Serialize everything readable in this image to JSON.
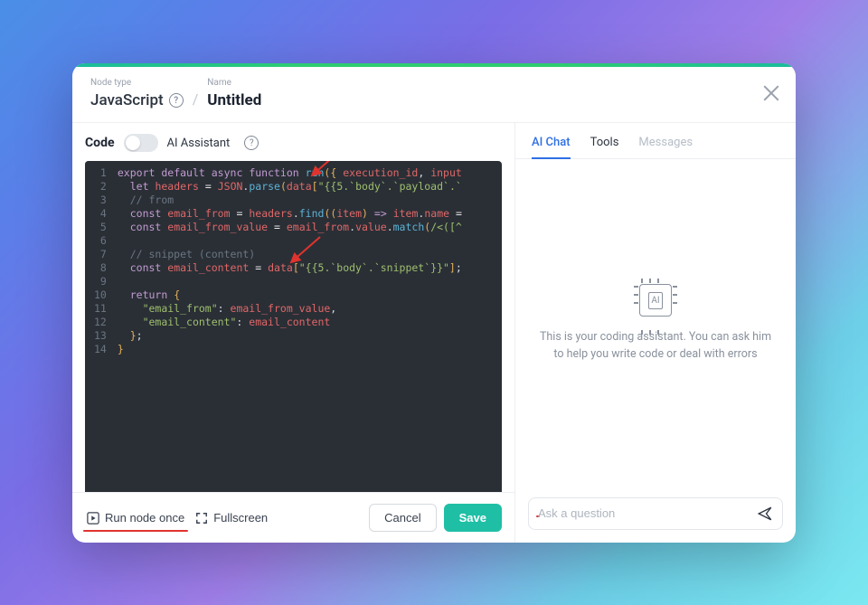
{
  "header": {
    "node_type_label": "Node type",
    "node_type": "JavaScript",
    "name_label": "Name",
    "name": "Untitled"
  },
  "left": {
    "code_label": "Code",
    "ai_assistant_label": "AI Assistant",
    "run_label": "Run node once",
    "fullscreen_label": "Fullscreen",
    "cancel_label": "Cancel",
    "save_label": "Save"
  },
  "code_lines": [
    "export default async function run({ execution_id, input",
    "  let headers = JSON.parse(data[\"{{5.`body`.`payload`.`",
    "  // from",
    "  const email_from = headers.find((item) => item.name =",
    "  const email_from_value = email_from.value.match(/<([^",
    "",
    "  // snippet (content)",
    "  const email_content = data[\"{{5.`body`.`snippet`}}\"];",
    "",
    "  return {",
    "    \"email_from\": email_from_value,",
    "    \"email_content\": email_content",
    "  };",
    "}"
  ],
  "right": {
    "tabs": {
      "ai_chat": "AI Chat",
      "tools": "Tools",
      "messages": "Messages"
    },
    "assistant_text": "This is your coding assistant. You can ask him to help you write code or deal with errors",
    "chip_text": "AI",
    "ask_placeholder": "Ask a question"
  }
}
